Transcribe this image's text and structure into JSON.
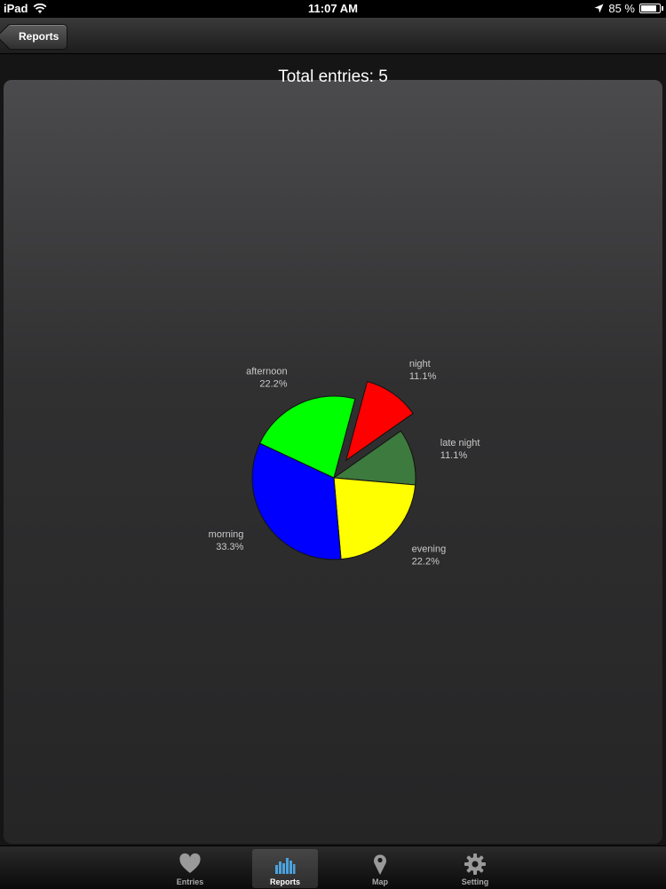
{
  "status_bar": {
    "device": "iPad",
    "time": "11:07 AM",
    "battery": "85 %",
    "battery_level": 0.85
  },
  "nav": {
    "back_label": "Reports"
  },
  "header": {
    "total_entries": "Total entries: 5"
  },
  "chart_data": {
    "type": "pie",
    "slices": [
      {
        "label": "night",
        "percent": "11.1%",
        "value": 11.1,
        "color": "#ff0000",
        "exploded": true
      },
      {
        "label": "late night",
        "percent": "11.1%",
        "value": 11.1,
        "color": "#3d7a3d",
        "exploded": false
      },
      {
        "label": "evening",
        "percent": "22.2%",
        "value": 22.2,
        "color": "#ffff00",
        "exploded": false
      },
      {
        "label": "morning",
        "percent": "33.3%",
        "value": 33.3,
        "color": "#0000ff",
        "exploded": false
      },
      {
        "label": "afternoon",
        "percent": "22.2%",
        "value": 22.2,
        "color": "#00ff00",
        "exploded": false
      }
    ]
  },
  "tab_bar": {
    "tabs": [
      {
        "label": "Entries",
        "icon": "heart-icon",
        "active": false
      },
      {
        "label": "Reports",
        "icon": "bar-chart-icon",
        "active": true
      },
      {
        "label": "Map",
        "icon": "map-pin-icon",
        "active": false
      },
      {
        "label": "Setting",
        "icon": "gear-icon",
        "active": false
      }
    ],
    "active_color": "#4aa3df"
  }
}
